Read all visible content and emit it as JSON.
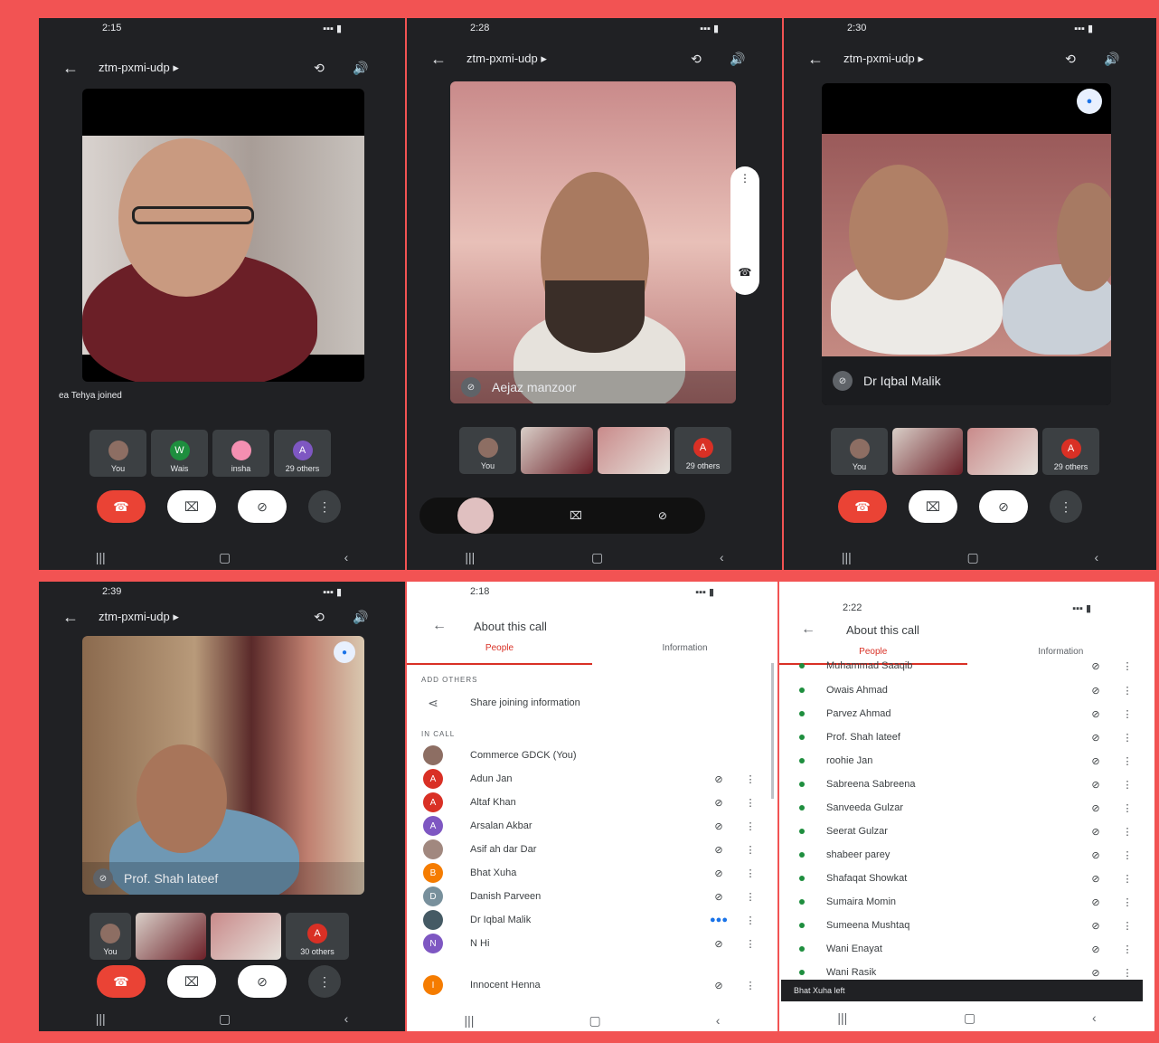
{
  "screens": {
    "s1": {
      "time": "2:15",
      "call_code": "ztm-pxmi-udp",
      "joined_msg": "ea Tehya joined",
      "tiles": [
        {
          "label": "You",
          "avatar": "",
          "color": "#8d6e63"
        },
        {
          "label": "Wais",
          "avatar": "W",
          "color": "#1e8e3e"
        },
        {
          "label": "insha",
          "avatar": "",
          "color": "#f48fb1"
        },
        {
          "label": "29 others",
          "avatar": "A",
          "color": "#7e57c2"
        }
      ]
    },
    "s2": {
      "time": "2:28",
      "call_code": "ztm-pxmi-udp",
      "speaker_name": "Aejaz manzoor",
      "tiles_label_you": "You",
      "tiles_others": "29 others"
    },
    "s3": {
      "time": "2:30",
      "call_code": "ztm-pxmi-udp",
      "speaker_name": "Dr Iqbal Malik",
      "tiles_label_you": "You",
      "tiles_others": "29 others"
    },
    "s4": {
      "time": "2:39",
      "call_code": "ztm-pxmi-udp",
      "speaker_name": "Prof. Shah lateef",
      "tiles_label_you": "You",
      "tiles_others": "30 others"
    },
    "s5": {
      "time": "2:18",
      "title": "About this call",
      "tab_people": "People",
      "tab_info": "Information",
      "add_others": "ADD OTHERS",
      "share": "Share joining information",
      "in_call": "IN CALL",
      "people": [
        {
          "name": "Commerce GDCK (You)",
          "initial": "",
          "color": "#8d6e63"
        },
        {
          "name": "Adun Jan",
          "initial": "A",
          "color": "#d93025"
        },
        {
          "name": "Altaf Khan",
          "initial": "A",
          "color": "#d93025"
        },
        {
          "name": "Arsalan Akbar",
          "initial": "A",
          "color": "#7e57c2"
        },
        {
          "name": "Asif ah dar Dar",
          "initial": "",
          "color": "#a1887f"
        },
        {
          "name": "Bhat Xuha",
          "initial": "B",
          "color": "#f57c00"
        },
        {
          "name": "Danish Parveen",
          "initial": "D",
          "color": "#78909c"
        },
        {
          "name": "Dr Iqbal Malik",
          "initial": "",
          "color": "#455a64"
        },
        {
          "name": "N Hi",
          "initial": "N",
          "color": "#7e57c2"
        },
        {
          "name": "Innocent Henna",
          "initial": "I",
          "color": "#f57c00"
        }
      ]
    },
    "s6": {
      "time": "2:22",
      "title": "About this call",
      "tab_people": "People",
      "tab_info": "Information",
      "people": [
        "Muhammad Saaqib",
        "Owais Ahmad",
        "Parvez Ahmad",
        "Prof. Shah lateef",
        "roohie Jan",
        "Sabreena Sabreena",
        "Sanveeda Gulzar",
        "Seerat Gulzar",
        "shabeer parey",
        "Shafaqat Showkat",
        "Sumaira Momin",
        "Sumeena Mushtaq",
        "Wani Enayat",
        "Wani Rasik"
      ],
      "toast": "Bhat Xuha left"
    }
  },
  "icons": {
    "back": "←",
    "camera_switch": "⟲",
    "speaker": "🔊",
    "dropdown": "▸",
    "end_call": "☎",
    "cam_off": "⌧",
    "mic_off": "⊘",
    "more": "⋮",
    "nav_recent": "|||",
    "nav_home": "▢",
    "nav_back": "‹",
    "share": "⋖"
  }
}
